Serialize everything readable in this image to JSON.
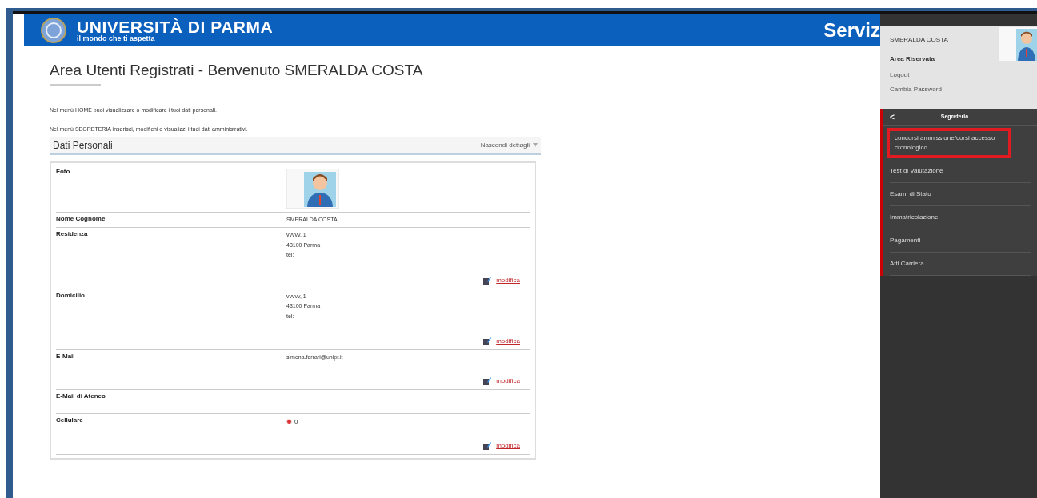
{
  "header": {
    "university": "UNIVERSITÀ DI PARMA",
    "tagline": "il mondo che ti aspetta",
    "service": "Serviz"
  },
  "page_title": "Area Utenti Registrati - Benvenuto SMERALDA COSTA",
  "intro": [
    "Nel menù HOME puoi visualizzare o modificare i tuoi dati personali.",
    "Nel menù SEGRETERIA inserisci, modifichi o visualizzi i tuoi dati amministrativi."
  ],
  "section": {
    "title": "Dati Personali",
    "toggle": "Nascondi dettagli"
  },
  "rows": [
    {
      "label": "Foto"
    },
    {
      "kind": "text",
      "label": "Nome Cognome",
      "values": [
        "SMERALDA COSTA"
      ]
    },
    {
      "kind": "text",
      "label": "Residenza",
      "values": [
        "vvvvv, 1",
        "43100 Parma",
        "tel:"
      ],
      "action": "modifica"
    },
    {
      "kind": "text",
      "label": "Domicilio",
      "values": [
        "vvvvv, 1",
        "43100 Parma",
        "tel:"
      ],
      "action": "modifica"
    },
    {
      "kind": "text",
      "label": "E-Mail",
      "values": [
        "simona.ferrari@unipr.it"
      ],
      "action": "modifica"
    },
    {
      "kind": "text",
      "label": "E-Mail di Ateneo"
    },
    {
      "kind": "phone",
      "label": "Cellulare",
      "values": [
        "0"
      ],
      "action": "modifica"
    }
  ],
  "side_menu": {
    "user": "SMERALDA COSTA",
    "area_title": "Area Riservata",
    "links": [
      "Logout",
      "Cambia Password"
    ],
    "back": "<",
    "section": "Segreteria",
    "items": [
      {
        "label": "concorsi ammissione/corsi accesso cronologico",
        "highlighted": true
      },
      {
        "label": "Test di Valutazione",
        "highlighted": false
      },
      {
        "label": "Esami di Stato",
        "highlighted": false
      },
      {
        "label": "Immatricolazione",
        "highlighted": false
      },
      {
        "label": "Pagamenti",
        "highlighted": false
      },
      {
        "label": "Atti Carriera",
        "highlighted": false
      }
    ]
  }
}
